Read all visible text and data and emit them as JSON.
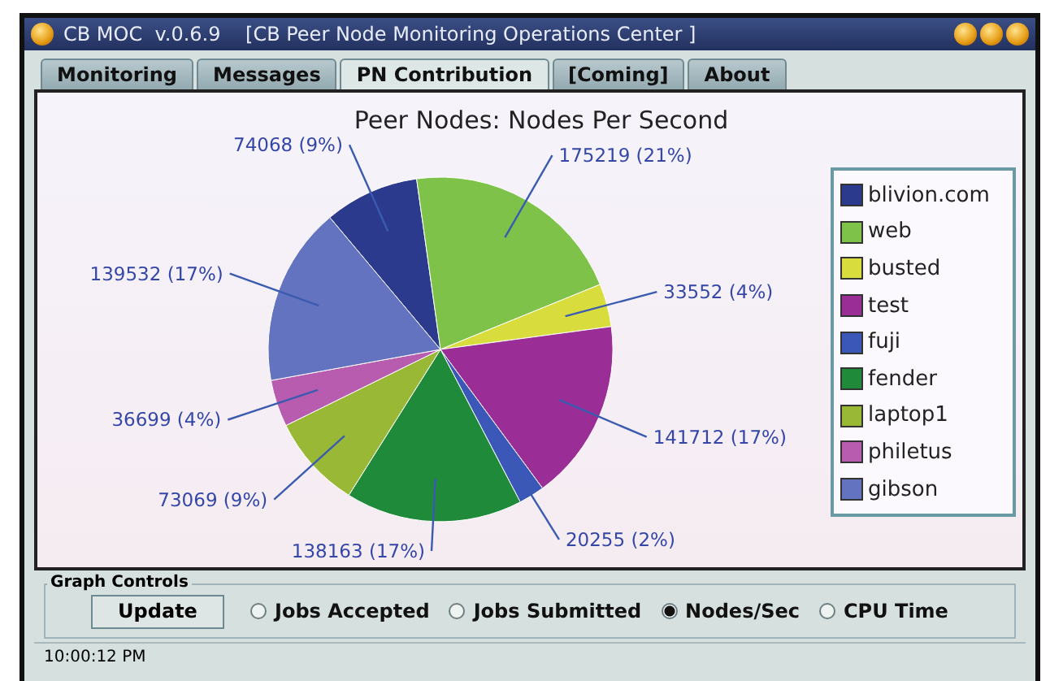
{
  "window": {
    "title": "CB MOC  v.0.6.9    [CB Peer Node Monitoring Operations Center ]"
  },
  "tabs": [
    {
      "label": "Monitoring",
      "selected": false
    },
    {
      "label": "Messages",
      "selected": false
    },
    {
      "label": "PN Contribution",
      "selected": true
    },
    {
      "label": "[Coming]",
      "selected": false
    },
    {
      "label": "About",
      "selected": false
    }
  ],
  "chart": {
    "chart_data": {
      "type": "pie",
      "title": "Peer Nodes: Nodes Per Second",
      "categories": [
        "blivion.com",
        "web",
        "busted",
        "test",
        "fuji",
        "fender",
        "laptop1",
        "philetus",
        "gibson"
      ],
      "values": [
        74068,
        175219,
        33552,
        141712,
        20255,
        138163,
        73069,
        36699,
        139532
      ],
      "value_labels": [
        "74068 (9%)",
        "175219 (21%)",
        "33552 (4%)",
        "141712 (17%)",
        "20255 (2%)",
        "138163 (17%)",
        "73069 (9%)",
        "36699 (4%)",
        "139532 (17%)"
      ]
    },
    "legend": [
      {
        "color": "#2b3a8c"
      },
      {
        "color": "#7ec24a"
      },
      {
        "color": "#d8dc3c"
      },
      {
        "color": "#9a2e96"
      },
      {
        "color": "#3b58b8"
      },
      {
        "color": "#1f8a3a"
      },
      {
        "color": "#98b836"
      },
      {
        "color": "#b85cb0"
      },
      {
        "color": "#6373c0"
      }
    ]
  },
  "graph_controls": {
    "title": "Graph Controls",
    "button": "Update",
    "options": [
      {
        "label": "Jobs Accepted",
        "selected": false
      },
      {
        "label": "Jobs Submitted",
        "selected": false
      },
      {
        "label": "Nodes/Sec",
        "selected": true
      },
      {
        "label": "CPU Time",
        "selected": false
      }
    ]
  },
  "status_bar": "10:00:12 PM"
}
